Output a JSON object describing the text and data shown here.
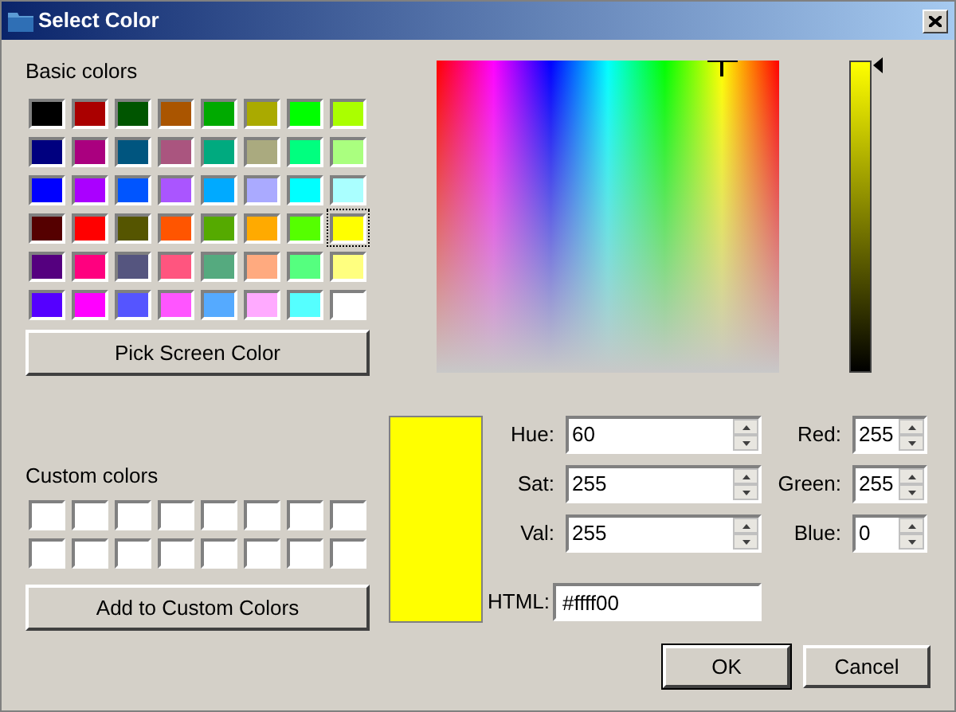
{
  "window": {
    "title": "Select Color"
  },
  "basic_colors": {
    "label": "Basic colors",
    "swatches": [
      {
        "color": "#000000",
        "selected": false
      },
      {
        "color": "#aa0000",
        "selected": false
      },
      {
        "color": "#005500",
        "selected": false
      },
      {
        "color": "#aa5500",
        "selected": false
      },
      {
        "color": "#00aa00",
        "selected": false
      },
      {
        "color": "#aaaa00",
        "selected": false
      },
      {
        "color": "#00ff00",
        "selected": false
      },
      {
        "color": "#aaff00",
        "selected": false
      },
      {
        "color": "#00007f",
        "selected": false
      },
      {
        "color": "#aa007f",
        "selected": false
      },
      {
        "color": "#00557f",
        "selected": false
      },
      {
        "color": "#aa557f",
        "selected": false
      },
      {
        "color": "#00aa7f",
        "selected": false
      },
      {
        "color": "#aaaa7f",
        "selected": false
      },
      {
        "color": "#00ff7f",
        "selected": false
      },
      {
        "color": "#aaff7f",
        "selected": false
      },
      {
        "color": "#0000ff",
        "selected": false
      },
      {
        "color": "#aa00ff",
        "selected": false
      },
      {
        "color": "#0055ff",
        "selected": false
      },
      {
        "color": "#aa55ff",
        "selected": false
      },
      {
        "color": "#00aaff",
        "selected": false
      },
      {
        "color": "#aaaaff",
        "selected": false
      },
      {
        "color": "#00ffff",
        "selected": false
      },
      {
        "color": "#aaffff",
        "selected": false
      },
      {
        "color": "#550000",
        "selected": false
      },
      {
        "color": "#ff0000",
        "selected": false
      },
      {
        "color": "#555500",
        "selected": false
      },
      {
        "color": "#ff5500",
        "selected": false
      },
      {
        "color": "#55aa00",
        "selected": false
      },
      {
        "color": "#ffaa00",
        "selected": false
      },
      {
        "color": "#55ff00",
        "selected": false
      },
      {
        "color": "#ffff00",
        "selected": true
      },
      {
        "color": "#55007f",
        "selected": false
      },
      {
        "color": "#ff007f",
        "selected": false
      },
      {
        "color": "#55557f",
        "selected": false
      },
      {
        "color": "#ff557f",
        "selected": false
      },
      {
        "color": "#55aa7f",
        "selected": false
      },
      {
        "color": "#ffaa7f",
        "selected": false
      },
      {
        "color": "#55ff7f",
        "selected": false
      },
      {
        "color": "#ffff7f",
        "selected": false
      },
      {
        "color": "#5500ff",
        "selected": false
      },
      {
        "color": "#ff00ff",
        "selected": false
      },
      {
        "color": "#5555ff",
        "selected": false
      },
      {
        "color": "#ff55ff",
        "selected": false
      },
      {
        "color": "#55aaff",
        "selected": false
      },
      {
        "color": "#ffaaff",
        "selected": false
      },
      {
        "color": "#55ffff",
        "selected": false
      },
      {
        "color": "#ffffff",
        "selected": false
      }
    ]
  },
  "pick_button": "Pick Screen Color",
  "custom_colors": {
    "label": "Custom colors",
    "swatches": [
      {
        "color": "#ffffff"
      },
      {
        "color": "#ffffff"
      },
      {
        "color": "#ffffff"
      },
      {
        "color": "#ffffff"
      },
      {
        "color": "#ffffff"
      },
      {
        "color": "#ffffff"
      },
      {
        "color": "#ffffff"
      },
      {
        "color": "#ffffff"
      },
      {
        "color": "#ffffff"
      },
      {
        "color": "#ffffff"
      },
      {
        "color": "#ffffff"
      },
      {
        "color": "#ffffff"
      },
      {
        "color": "#ffffff"
      },
      {
        "color": "#ffffff"
      },
      {
        "color": "#ffffff"
      },
      {
        "color": "#ffffff"
      }
    ]
  },
  "add_button": "Add to Custom Colors",
  "hsv_fields": [
    {
      "label": "Hue:",
      "value": "60"
    },
    {
      "label": "Sat:",
      "value": "255"
    },
    {
      "label": "Val:",
      "value": "255"
    }
  ],
  "rgb_fields": [
    {
      "label": "Red:",
      "value": "255"
    },
    {
      "label": "Green:",
      "value": "255"
    },
    {
      "label": "Blue:",
      "value": "0"
    }
  ],
  "html": {
    "label": "HTML:",
    "value": "#ffff00"
  },
  "buttons": [
    {
      "label": "OK",
      "default": true
    },
    {
      "label": "Cancel",
      "default": false
    }
  ]
}
